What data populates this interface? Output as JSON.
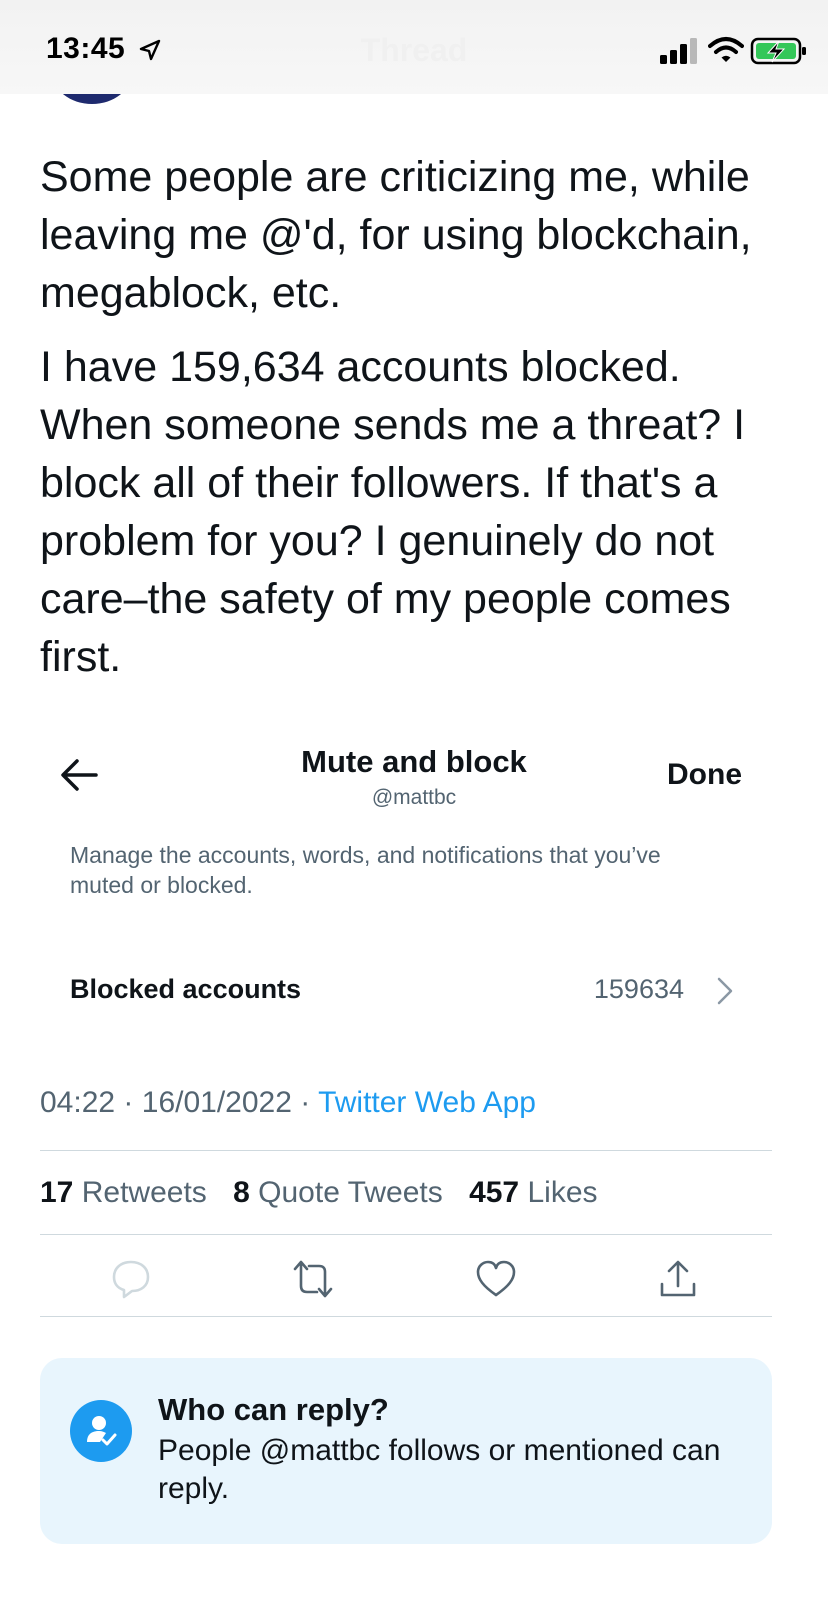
{
  "status_bar": {
    "time": "13:45",
    "ghost_title": "Thread"
  },
  "tweet": {
    "paragraphs": [
      "Some people are criticizing me, while leaving me @'d, for using blockchain, megablock, etc.",
      "I have 159,634 accounts blocked. When someone sends me a threat? I block all of their followers. If that's a problem for you? I genuinely do not care–the safety of my people comes first."
    ]
  },
  "embedded_screenshot": {
    "title": "Mute and block",
    "handle": "@mattbc",
    "done_label": "Done",
    "description": "Manage the accounts, words, and notifications that you’ve muted or blocked.",
    "row_label": "Blocked accounts",
    "row_count": "159634"
  },
  "meta": {
    "time": "04:22",
    "date": "16/01/2022",
    "separator": "·",
    "source": "Twitter Web App"
  },
  "stats": {
    "retweets_count": "17",
    "retweets_label": "Retweets",
    "quotes_count": "8",
    "quotes_label": "Quote Tweets",
    "likes_count": "457",
    "likes_label": "Likes"
  },
  "who_can_reply": {
    "title": "Who can reply?",
    "body": "People @mattbc follows or mentioned can reply."
  },
  "colors": {
    "accent": "#1d9bf0",
    "secondary_text": "#536471",
    "reply_card_bg": "#e8f5fd"
  }
}
